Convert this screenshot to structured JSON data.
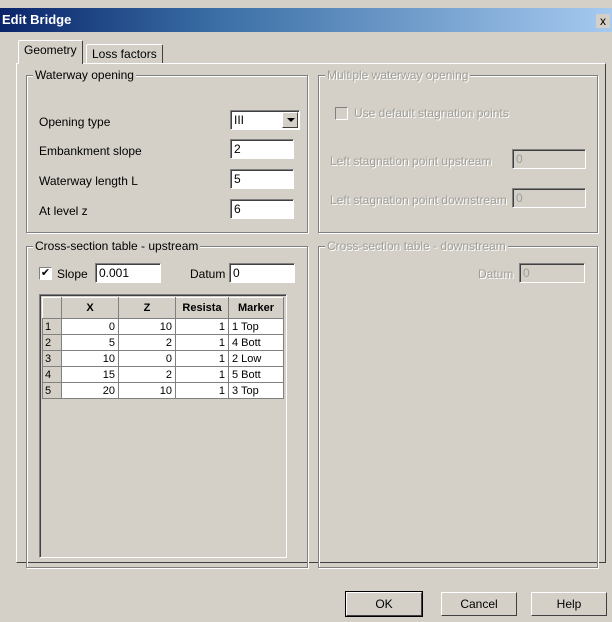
{
  "window": {
    "title": "Edit Bridge",
    "close": "x"
  },
  "tabs": [
    {
      "label": "Geometry"
    },
    {
      "label": "Loss factors"
    }
  ],
  "waterway": {
    "legend": "Waterway opening",
    "opening_type_label": "Opening type",
    "opening_type_value": "III",
    "embankment_label": "Embankment slope",
    "embankment_value": "2",
    "length_label": "Waterway length L",
    "length_value": "5",
    "level_label": "At level z",
    "level_value": "6"
  },
  "multiple": {
    "legend": "Multiple waterway opening",
    "use_default_label": "Use default stagnation points",
    "left_up_label": "Left stagnation point upstream",
    "left_up_value": "0",
    "left_down_label": "Left stagnation point downstream",
    "left_down_value": "0"
  },
  "upstream": {
    "legend": "Cross-section table - upstream",
    "slope_label": "Slope",
    "slope_value": "0.001",
    "datum_label": "Datum",
    "datum_value": "0",
    "columns": [
      "X",
      "Z",
      "Resista",
      "Marker"
    ],
    "rows": [
      {
        "n": "1",
        "x": "0",
        "z": "10",
        "r": "1",
        "m": "1 Top"
      },
      {
        "n": "2",
        "x": "5",
        "z": "2",
        "r": "1",
        "m": "4 Bott"
      },
      {
        "n": "3",
        "x": "10",
        "z": "0",
        "r": "1",
        "m": "2 Low"
      },
      {
        "n": "4",
        "x": "15",
        "z": "2",
        "r": "1",
        "m": "5 Bott"
      },
      {
        "n": "5",
        "x": "20",
        "z": "10",
        "r": "1",
        "m": "3 Top"
      }
    ]
  },
  "downstream": {
    "legend": "Cross-section table - downstream",
    "datum_label": "Datum",
    "datum_value": "0"
  },
  "buttons": {
    "ok": "OK",
    "cancel": "Cancel",
    "help": "Help"
  }
}
